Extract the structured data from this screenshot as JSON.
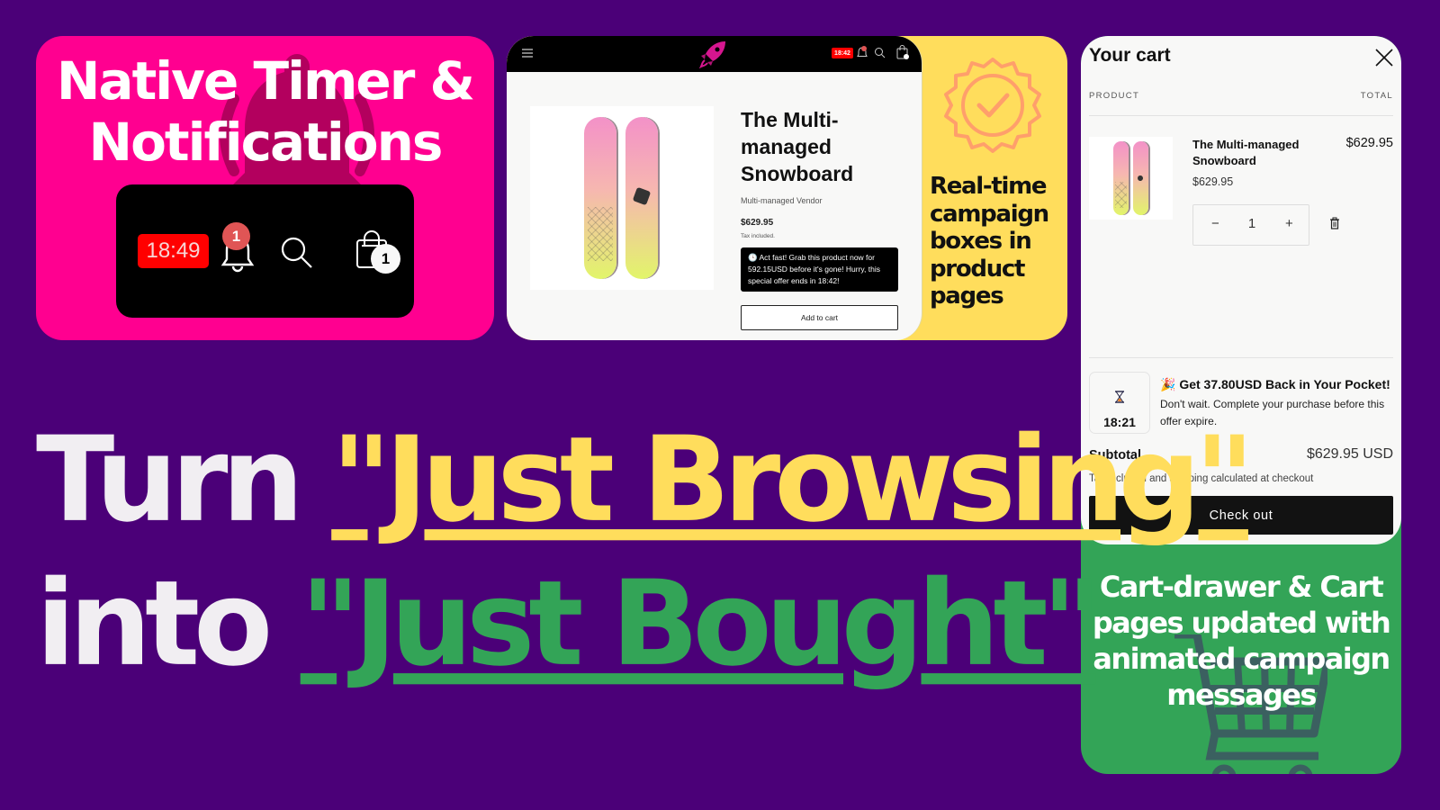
{
  "colors": {
    "background": "#4b0078",
    "pink": "#ff0090",
    "yellow": "#ffdd5c",
    "green": "#33a457",
    "timer_red": "#ff0000"
  },
  "card_timer": {
    "title_line1": "Native Timer &",
    "title_line2": "Notifications",
    "timer": "18:49",
    "bell_count": "1",
    "bag_count": "1",
    "icons": [
      "bell-icon",
      "search-icon",
      "shopping-bag-icon"
    ]
  },
  "card_product": {
    "nav": {
      "menu_icon": "hamburger-menu-icon",
      "logo_icon": "rocket-icon",
      "timer": "18:42",
      "bell_count": "1",
      "bag_count": "1"
    },
    "product": {
      "title": "The Multi-managed Snowboard",
      "vendor": "Multi-managed Vendor",
      "price": "$629.95",
      "tax_note": "Tax included.",
      "campaign_message": "🕒 Act fast! Grab this product now for 592.15USD before it's gone! Hurry, this special offer ends in 18:42!",
      "add_to_cart": "Add to cart"
    },
    "caption": "Real-time campaign boxes in product pages"
  },
  "card_cart": {
    "title": "Your cart",
    "col_product": "PRODUCT",
    "col_total": "TOTAL",
    "item": {
      "name": "The Multi-managed Snowboard",
      "unit_price": "$629.95",
      "total": "$629.95",
      "quantity": "1",
      "minus": "−",
      "plus": "+"
    },
    "campaign": {
      "timer": "18:21",
      "title": "🎉 Get 37.80USD Back in Your Pocket!",
      "body": "Don't wait. Complete your purchase before this offer expire."
    },
    "subtotal_label": "Subtotal",
    "subtotal_value": "$629.95 USD",
    "tax_note": "Tax included and shipping calculated at checkout",
    "checkout": "Check out",
    "caption": "Cart-drawer & Cart pages updated with animated campaign messages"
  },
  "headline": {
    "line1_prefix": "Turn ",
    "line1_highlight": "\"Just Browsing\"",
    "line2_prefix": "into ",
    "line2_highlight": "\"Just Bought\""
  }
}
